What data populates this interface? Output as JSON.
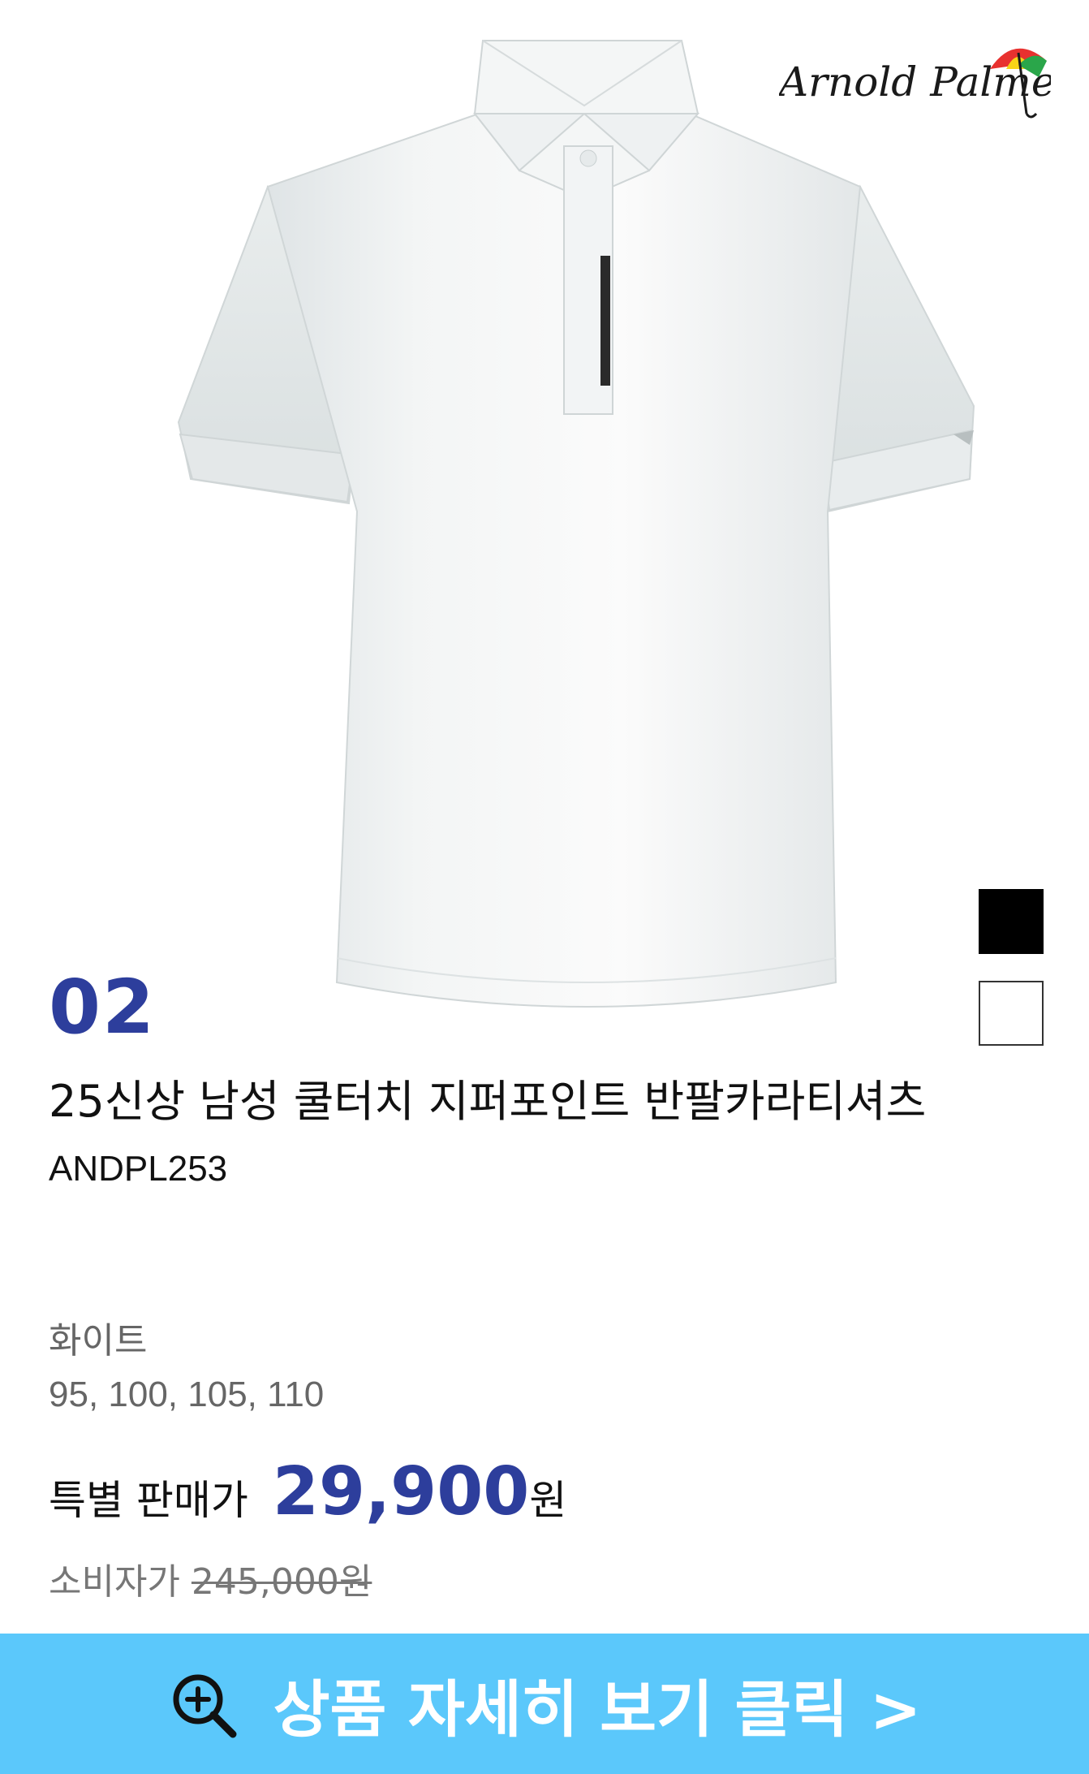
{
  "brand": {
    "logo_text": "Arnold Palmer",
    "umbrella_colors": [
      "#e8312f",
      "#f7d417",
      "#2aa64a",
      "#ffffff"
    ]
  },
  "product": {
    "item_number": "02",
    "title": "25신상 남성 쿨터치 지퍼포인트 반팔카라티셔츠",
    "code": "ANDPL253",
    "color": "화이트",
    "sizes": "95, 100, 105, 110",
    "swatches": [
      {
        "name": "black",
        "hex": "#000000"
      },
      {
        "name": "white",
        "hex": "#ffffff"
      }
    ]
  },
  "price": {
    "sale_label": "특별 판매가",
    "sale_value": "29,900",
    "sale_unit": "원",
    "msrp_label": "소비자가",
    "msrp_value": "245,000원"
  },
  "cta": {
    "label": "상품 자세히 보기 클릭 >",
    "icon": "zoom-in-icon",
    "background": "#5bc8fb"
  },
  "colors": {
    "accent": "#2d3e9c",
    "muted": "#666666"
  }
}
